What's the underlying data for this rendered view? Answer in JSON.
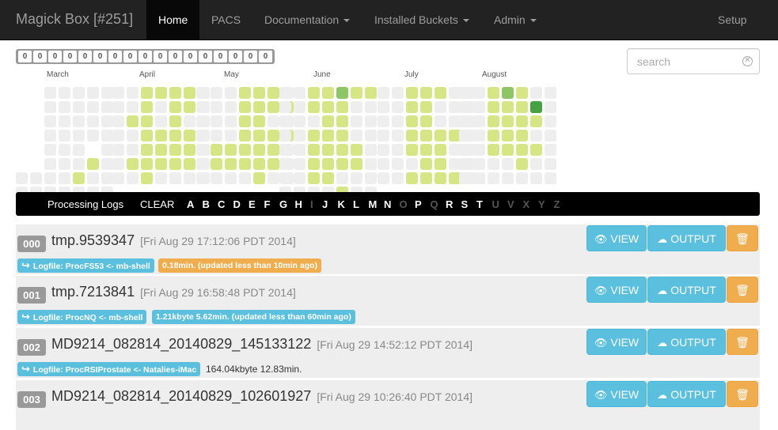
{
  "nav": {
    "brand": "Magick Box [#251]",
    "items": [
      {
        "label": "Home",
        "active": true
      },
      {
        "label": "PACS"
      },
      {
        "label": "Documentation",
        "dropdown": true
      },
      {
        "label": "Installed Buckets",
        "dropdown": true
      },
      {
        "label": "Admin",
        "dropdown": true
      }
    ],
    "setup": "Setup"
  },
  "counters": [
    "0",
    "0",
    "0",
    "0",
    "0",
    "0",
    "0",
    "0",
    "0",
    "0",
    "0",
    "0",
    "0",
    "0",
    "0",
    "0",
    "0"
  ],
  "search": {
    "placeholder": "search",
    "value": ""
  },
  "calendar": {
    "months": [
      "March",
      "April",
      "May",
      "June",
      "July",
      "August"
    ],
    "colors": {
      "empty": "#eeeeee",
      "low": "#d6e685",
      "mid": "#8cc665",
      "high": "#44a340"
    }
  },
  "filter": {
    "title": "Processing Logs",
    "clear": "CLEAR",
    "letters": [
      {
        "l": "A",
        "on": true
      },
      {
        "l": "B",
        "on": true
      },
      {
        "l": "C",
        "on": true
      },
      {
        "l": "D",
        "on": true
      },
      {
        "l": "E",
        "on": true
      },
      {
        "l": "F",
        "on": true
      },
      {
        "l": "G",
        "on": true
      },
      {
        "l": "H",
        "on": true
      },
      {
        "l": "I",
        "on": false
      },
      {
        "l": "J",
        "on": true
      },
      {
        "l": "K",
        "on": true
      },
      {
        "l": "L",
        "on": true
      },
      {
        "l": "M",
        "on": true
      },
      {
        "l": "N",
        "on": true
      },
      {
        "l": "O",
        "on": false
      },
      {
        "l": "P",
        "on": true
      },
      {
        "l": "Q",
        "on": false
      },
      {
        "l": "R",
        "on": true
      },
      {
        "l": "S",
        "on": true
      },
      {
        "l": "T",
        "on": true
      },
      {
        "l": "U",
        "on": false
      },
      {
        "l": "V",
        "on": false
      },
      {
        "l": "X",
        "on": false
      },
      {
        "l": "Y",
        "on": false
      },
      {
        "l": "Z",
        "on": false
      }
    ]
  },
  "buttons": {
    "view": "VIEW",
    "output": "OUTPUT"
  },
  "logs": [
    {
      "index": "000",
      "name": "tmp.9539347",
      "date": "[Fri Aug 29 17:12:06 PDT 2014]",
      "logfile": "Logfile: ProcFS53 <- mb-shell",
      "status": "0.18min. (updated less than 10min ago)",
      "status_style": "warn"
    },
    {
      "index": "001",
      "name": "tmp.7213841",
      "date": "[Fri Aug 29 16:58:48 PDT 2014]",
      "logfile": "Logfile: ProcNQ <- mb-shell",
      "status": "1.21kbyte 5.62min. (updated less than 60min ago)",
      "status_style": "info"
    },
    {
      "index": "002",
      "name": "MD9214_082814_20140829_145133122",
      "date": "[Fri Aug 29 14:52:12 PDT 2014]",
      "logfile": "Logfile: ProcRSIProstate <- Natalies-iMac",
      "status": "164.04kbyte 12.83min.",
      "status_style": "plain"
    },
    {
      "index": "003",
      "name": "MD9214_082814_20140829_102601927",
      "date": "[Fri Aug 29 10:26:40 PDT 2014]",
      "logfile": "",
      "status": "",
      "status_style": "plain"
    }
  ]
}
